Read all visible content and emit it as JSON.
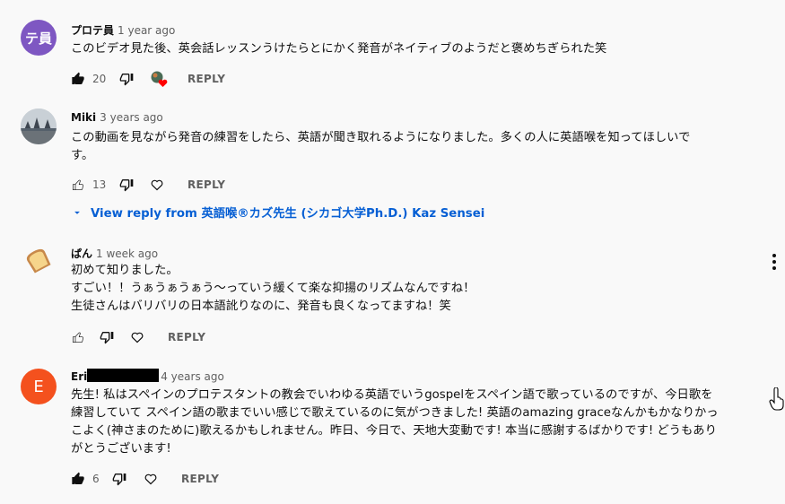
{
  "comments": [
    {
      "avatar_text": "テ員",
      "avatar_color": "#7e57c2",
      "author": "プロテ員",
      "time": "1 year ago",
      "text": "このビデオ見た後、英会話レッスンうけたらとにかく発音がネイティブのようだと褒めちぎられた笑",
      "likes": "20",
      "liked": true,
      "creator_heart": true,
      "reply_label": "REPLY"
    },
    {
      "avatar_text": "",
      "author": "Miki",
      "time": "3 years ago",
      "text": "この動画を見ながら発音の練習をしたら、英語が聞き取れるようになりました。多くの人に英語喉を知ってほしいで\nす。",
      "likes": "13",
      "liked": false,
      "reply_label": "REPLY",
      "view_reply": "View reply from 英語喉®カズ先生 (シカゴ大学Ph.D.) Kaz Sensei"
    },
    {
      "avatar_text": "",
      "author": "ぱん",
      "time": "1 week ago",
      "text": "初めて知りました。\nすごい！！うぁうぁうぁう〜っていう緩くて楽な抑揚のリズムなんですね！\n生徒さんはバリバリの日本語訛りなのに、発音も良くなってますね！笑",
      "likes": "",
      "liked": false,
      "reply_label": "REPLY"
    },
    {
      "avatar_text": "E",
      "avatar_color": "#f4511e",
      "author": "Eri",
      "time": "4 years ago",
      "text": "先生! 私はスペインのプロテスタントの教会でいわゆる英語でいうgospelをスペイン語で歌っているのですが、今日歌を\n練習していて スペイン語の歌までいい感じで歌えているのに気がつきました! 英語のamazing graceなんかもかなりかっ\nこよく(神さまのために)歌えるかもしれません。昨日、今日で、天地大変動です! 本当に感謝するばかりです! どうもあり\nがとうございます!",
      "likes": "6",
      "liked": true,
      "reply_label": "REPLY"
    }
  ]
}
